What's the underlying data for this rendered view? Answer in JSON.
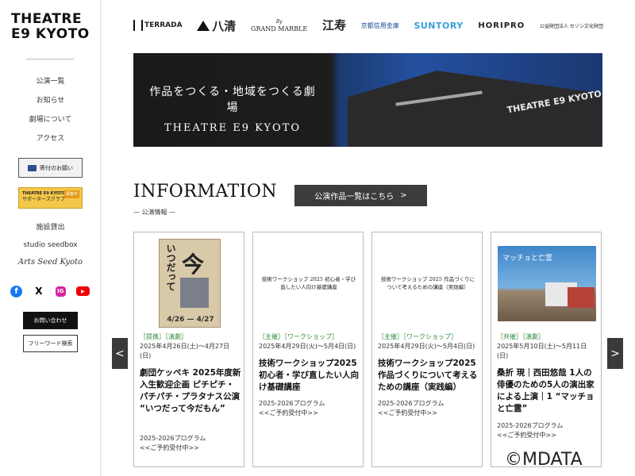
{
  "sidebar": {
    "logo_line1": "THEATRE",
    "logo_line2": "E9 KYOTO",
    "nav": [
      "公演一覧",
      "お知らせ",
      "劇場について",
      "アクセス"
    ],
    "donate_label": "寄付のお願い",
    "supporter_logo": "THEATRE E9 KYOTO",
    "supporter_label": "サポーターズクラブ",
    "supporter_badge": "募集中",
    "links": [
      "施設貸出",
      "studio seedbox",
      "Arts Seed Kyoto"
    ],
    "social": {
      "facebook": "f",
      "x": "X",
      "instagram": "IG",
      "youtube": "▶"
    },
    "contact_label": "お問い合わせ",
    "search_label": "フリーワード検索"
  },
  "sponsors": {
    "terrada": "TERRADA",
    "hassei": "八清",
    "gm_top": "By",
    "gm": "GRAND MARBLE",
    "ejyu": "江寿",
    "kyoto_shinkin": "京都信用金庫",
    "suntory": "SUNTORY",
    "horipro": "HORIPRO",
    "sezon": "公益財団法人 セゾン文化財団"
  },
  "banner": {
    "line1": "作品をつくる・地域をつくる劇場",
    "line2": "THEATRE E9 KYOTO",
    "building_sign": "THEATRE E9 KYOTO"
  },
  "information": {
    "title": "INFORMATION",
    "subtitle": "— 公演情報 —",
    "all_button": "公演作品一覧はこちら",
    "all_button_arrow": ">"
  },
  "cards": [
    {
      "thumb_type": "poster",
      "poster_side": "いつだって",
      "poster_big": "今",
      "poster_date": "4/26 — 4/27",
      "tags": "［提携］［演劇］",
      "date": "2025年4月26日(土)〜4月27日(日)",
      "title": "劇団ケッペキ 2025年度新入生歓迎企画 ピチピチ・パチパチ・プラタナス公演 “いつだって今だもん”",
      "program": "2025-2026プログラム",
      "reserve": "<<ご予約受付中>>"
    },
    {
      "thumb_type": "text",
      "thumb_text": "技術ワークショップ 2025 初心者・学び直したい人向け基礎講座",
      "tags": "［主催］［ワークショップ］",
      "date": "2025年4月29日(火)〜5月4日(日)",
      "title": "技術ワークショップ2025 初心者・学び直したい人向け基礎講座",
      "program": "2025-2026プログラム",
      "reserve": "<<ご予約受付中>>"
    },
    {
      "thumb_type": "text",
      "thumb_text": "技術ワークショップ 2025 作品づくりについて考えるための講座（実践編）",
      "tags": "［主催］［ワークショップ］",
      "date": "2025年4月29日(火)〜5月4日(日)",
      "title": "技術ワークショップ2025 作品づくりについて考えるための講座（実践編）",
      "program": "2025-2026プログラム",
      "reserve": "<<ご予約受付中>>"
    },
    {
      "thumb_type": "photo",
      "thumb_text": "マッチョと亡霊",
      "tags": "［共催］［演劇］",
      "date": "2025年5月10日(土)〜5月11日(日)",
      "title": "桑折 現｜西田悠哉 1人の俳優のための5人の演出家による上演｜1 “マッチョと亡霊”",
      "program": "2025-2026プログラム",
      "reserve": "<<ご予約受付中>>"
    }
  ],
  "arrows": {
    "left": "<",
    "right": ">"
  },
  "watermark": "©MDATA",
  "colors": {
    "tag_green": "#2e8a3b",
    "dark_button": "#3c3c3c",
    "suntory_blue": "#3aa0d8"
  }
}
